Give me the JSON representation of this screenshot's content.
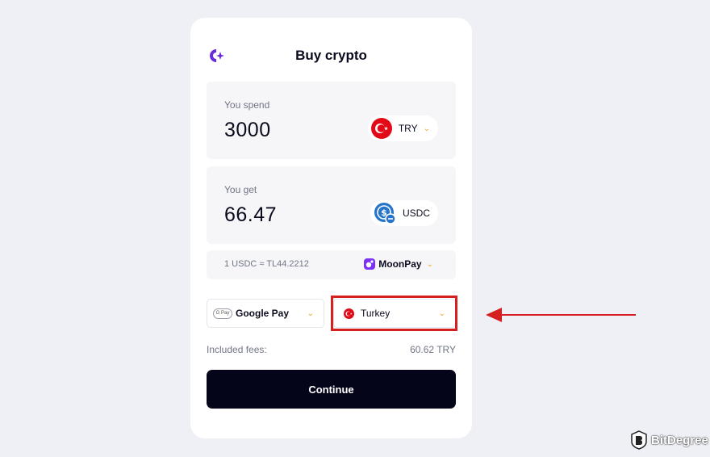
{
  "header": {
    "title": "Buy crypto"
  },
  "spend": {
    "label": "You spend",
    "amount": "3000",
    "currency": "TRY"
  },
  "get": {
    "label": "You get",
    "amount": "66.47",
    "currency": "USDC"
  },
  "rate": {
    "text": "1 USDC ≈ TL44.2212",
    "provider": "MoonPay"
  },
  "payment": {
    "badge": "G Pay",
    "label": "Google Pay"
  },
  "country": {
    "label": "Turkey"
  },
  "fees": {
    "label": "Included fees:",
    "value": "60.62 TRY"
  },
  "continue_label": "Continue",
  "watermark": {
    "name": "BitDegree"
  },
  "colors": {
    "accent": "#7b2ff7",
    "chevron": "#f5a623",
    "highlight": "#d62020",
    "button": "#05051a",
    "flag_red": "#e30a17",
    "usdc_blue": "#2775ca"
  },
  "icons": [
    "logo-icon",
    "turkey-flag-icon",
    "usdc-icon",
    "moonpay-icon",
    "chevron-down-icon",
    "google-pay-icon",
    "bitdegree-logo-icon"
  ]
}
